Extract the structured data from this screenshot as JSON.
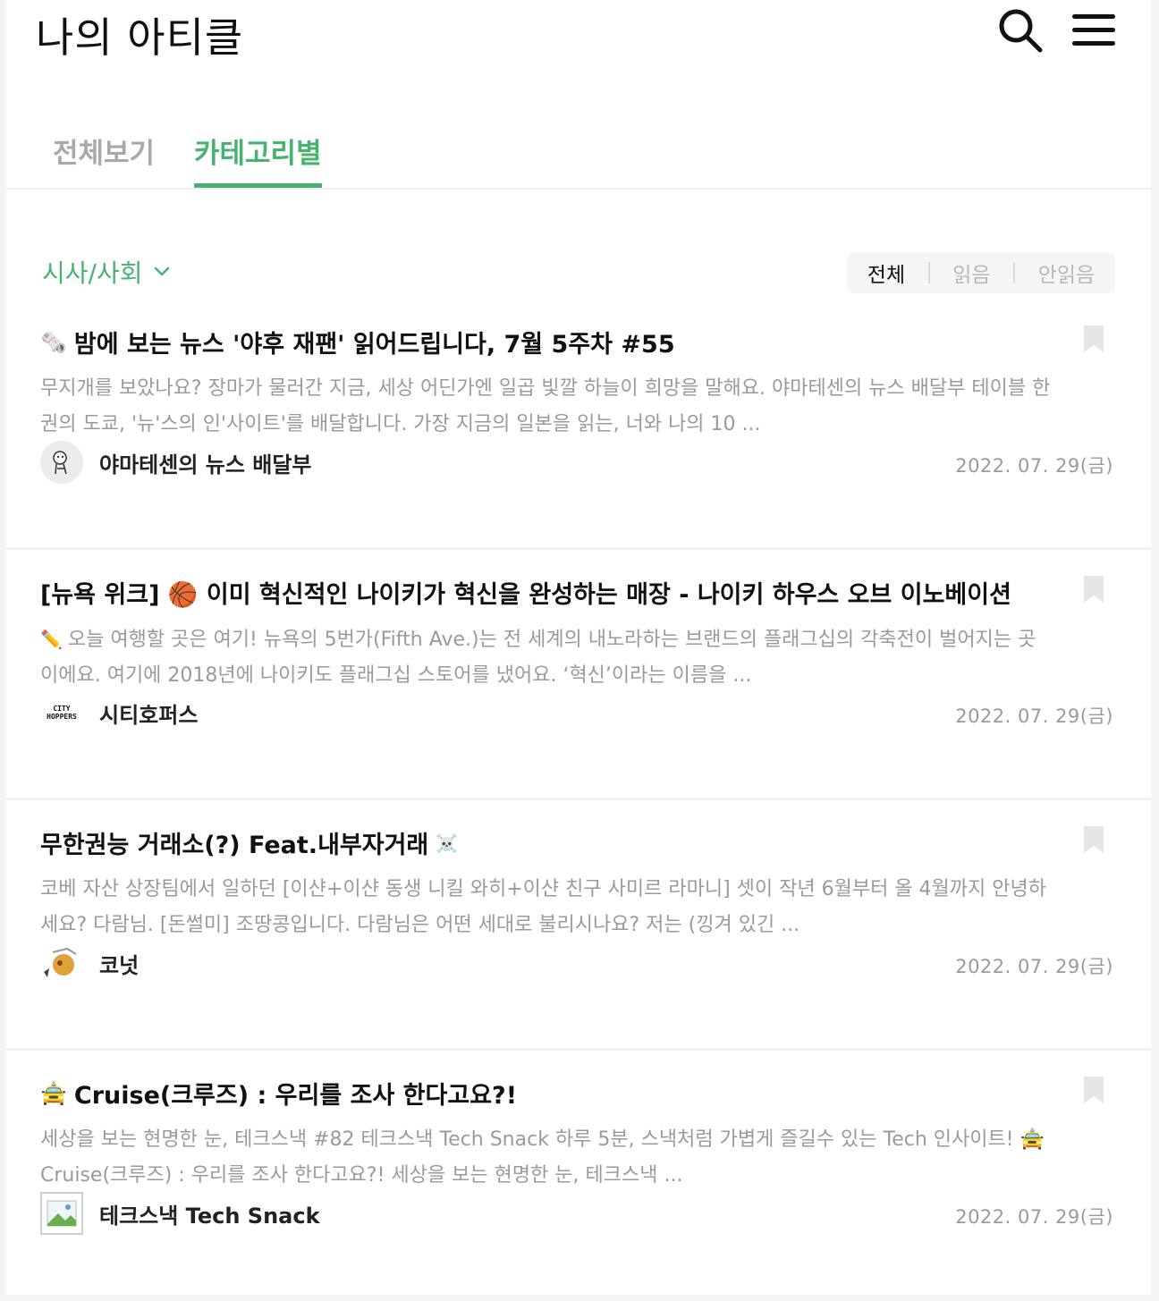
{
  "header": {
    "title": "나의 아티클",
    "search_icon": "search-icon",
    "menu_icon": "hamburger-menu-icon"
  },
  "tabs": [
    {
      "label": "전체보기",
      "active": false
    },
    {
      "label": "카테고리별",
      "active": true
    }
  ],
  "filter": {
    "category": "시사/사회",
    "read_filter": [
      {
        "label": "전체",
        "active": true
      },
      {
        "label": "읽음",
        "active": false
      },
      {
        "label": "안읽음",
        "active": false
      }
    ]
  },
  "colors": {
    "accent": "#47b36f",
    "muted": "#9a9a9a"
  },
  "articles": [
    {
      "title_emoji": "🗞️",
      "title": "밤에 보는 뉴스 '야후 재팬' 읽어드립니다, 7월 5주차 #55",
      "summary_emoji": "",
      "summary": "무지개를 보았나요? 장마가 물러간 지금, 세상 어딘가엔 일곱 빛깔 하늘이 희망을 말해요. 야마테센의 뉴스 배달부 테이블 한 권의 도쿄, '뉴'스의 인'사이트'를 배달합니다. 가장 지금의 일본을 읽는, 너와 나의 10 ...",
      "author": "야마테센의 뉴스 배달부",
      "date": "2022. 07. 29(금)"
    },
    {
      "title_emoji": "",
      "title": "[뉴욕 위크] 🏀 이미 혁신적인 나이키가 혁신을 완성하는 매장 - 나이키 하우스 오브 이노베이션",
      "summary_emoji": "✏️",
      "summary": "오늘 여행할 곳은 여기! 뉴욕의 5번가(Fifth Ave.)는 전 세계의 내노라하는 브랜드의 플래그십의 각축전이 벌어지는 곳이에요. 여기에 2018년에 나이키도 플래그십 스토어를 냈어요. ‘혁신’이라는 이름을 ...",
      "author": "시티호퍼스",
      "avatar_text": "CITY HOPPERS",
      "date": "2022. 07. 29(금)"
    },
    {
      "title_emoji": "",
      "title": "무한권능 거래소(?) Feat.내부자거래",
      "title_emoji_after": "☠️",
      "summary_emoji": "",
      "summary": "코베 자산 상장팀에서 일하던 [이샨+이샨 동생 니킬 와히+이샨 친구 사미르 라마니] 셋이 작년 6월부터 올 4월까지 안녕하세요? 다람님. [돈썰미] 조땅콩입니다. 다람님은 어떤 세대로 불리시나요? 저는 (낑겨 있긴 ...",
      "author": "코넛",
      "date": "2022. 07. 29(금)"
    },
    {
      "title_emoji": "🚖",
      "title": "Cruise(크루즈) : 우리를 조사 한다고요?!",
      "summary_emoji": "",
      "summary": "세상을 보는 현명한 눈, 테크스낵 #82 테크스낵 Tech Snack 하루 5분, 스낵처럼 가볍게 즐길수 있는 Tech 인사이트! 🚖 Cruise(크루즈) : 우리를 조사 한다고요?! 세상을 보는 현명한 눈, 테크스낵 ...",
      "author": "테크스낵 Tech Snack",
      "date": "2022. 07. 29(금)"
    }
  ]
}
